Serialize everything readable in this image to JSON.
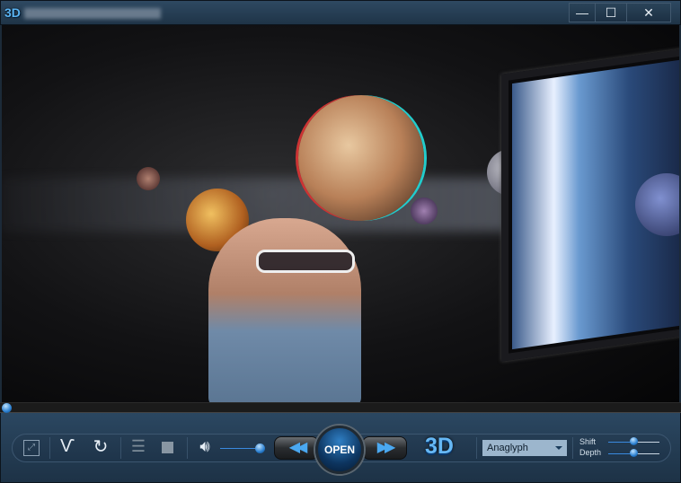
{
  "titlebar": {
    "logo": "3D",
    "minimize": "—",
    "maximize": "☐",
    "close": "✕"
  },
  "player": {
    "seek_progress": 0.0,
    "volume": 1.0,
    "open_label": "OPEN",
    "logo_3d": "3D",
    "mode_select": {
      "selected": "Anaglyph"
    },
    "shift": {
      "label": "Shift",
      "value": 0.5
    },
    "depth": {
      "label": "Depth",
      "value": 0.5
    }
  },
  "accent": "#3a8ae0"
}
